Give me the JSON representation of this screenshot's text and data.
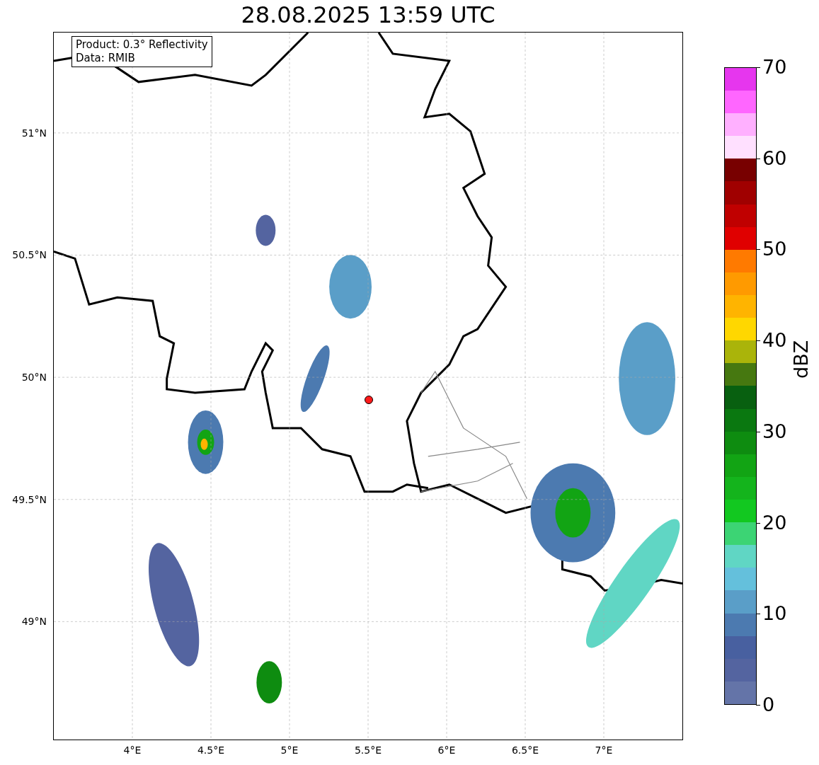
{
  "title": "28.08.2025 13:59 UTC",
  "info_box": {
    "lines": [
      "Product: 0.3° Reflectivity",
      "Data: RMIB"
    ]
  },
  "map": {
    "x_ticks": [
      "4°E",
      "4.5°E",
      "5°E",
      "5.5°E",
      "6°E",
      "6.5°E",
      "7°E"
    ],
    "y_ticks": [
      "51°N",
      "50.5°N",
      "50°N",
      "49.5°N",
      "49°N"
    ]
  },
  "colorbar": {
    "label": "dBZ",
    "ticks": [
      "70",
      "60",
      "50",
      "40",
      "30",
      "20",
      "10",
      "0"
    ],
    "segments": [
      {
        "color": "#6474a8"
      },
      {
        "color": "#5464a0"
      },
      {
        "color": "#4860a0"
      },
      {
        "color": "#4c7ab0"
      },
      {
        "color": "#5a9ec8"
      },
      {
        "color": "#64c0dc"
      },
      {
        "color": "#60d6c4"
      },
      {
        "color": "#3cd474"
      },
      {
        "color": "#12c820"
      },
      {
        "color": "#14b41c"
      },
      {
        "color": "#12a414"
      },
      {
        "color": "#0e8c10"
      },
      {
        "color": "#0a7810"
      },
      {
        "color": "#086010"
      },
      {
        "color": "#467810"
      },
      {
        "color": "#aab40a"
      },
      {
        "color": "#ffd700"
      },
      {
        "color": "#ffb400"
      },
      {
        "color": "#ff9a00"
      },
      {
        "color": "#ff7a00"
      },
      {
        "color": "#e00000"
      },
      {
        "color": "#c00000"
      },
      {
        "color": "#a00000"
      },
      {
        "color": "#780000"
      },
      {
        "color": "#ffe0ff"
      },
      {
        "color": "#ffb0ff"
      },
      {
        "color": "#ff66ff"
      },
      {
        "color": "#e636ee"
      }
    ]
  }
}
